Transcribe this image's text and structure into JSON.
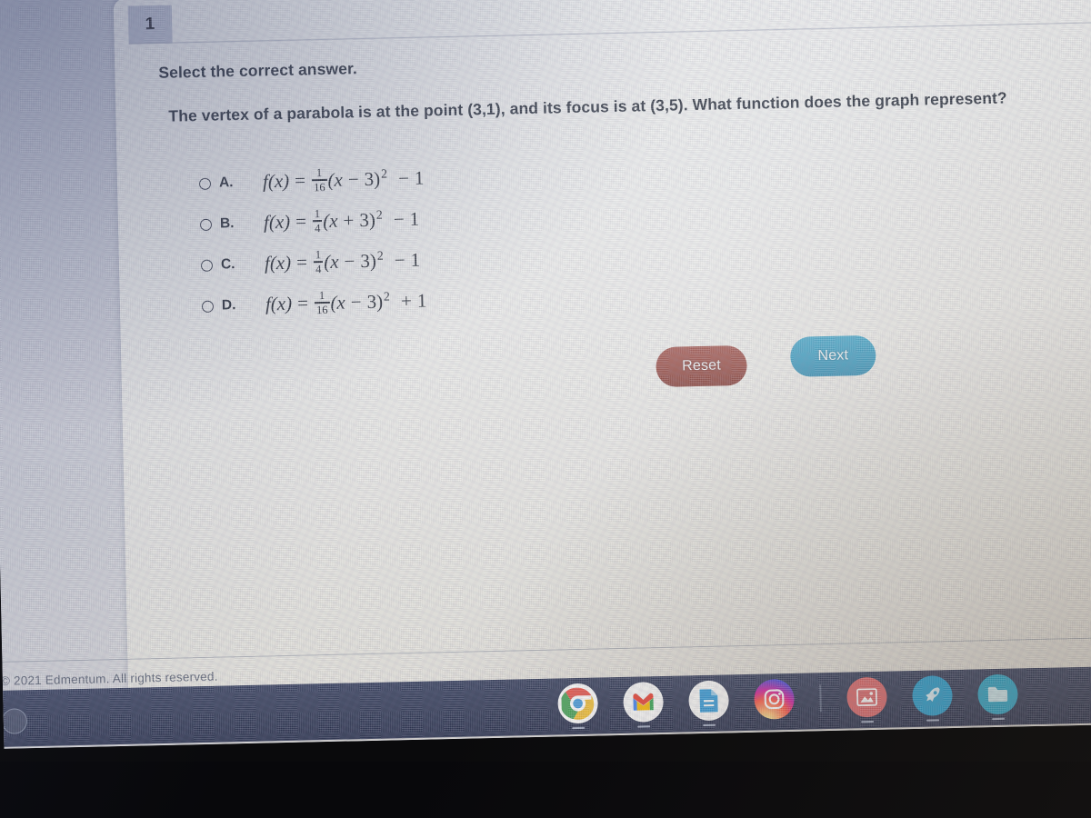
{
  "assessment": {
    "question_number": "1",
    "prompt": "Select the correct answer.",
    "question": "The vertex of a parabola is at the point (3,1), and its focus is at (3,5). What function does the graph represent?",
    "options": [
      {
        "letter": "A.",
        "selected": false,
        "expr_text": "f(x) = 1/16(x − 3)² − 1",
        "lhs": "f(x)",
        "eq": "=",
        "num": "1",
        "den": "16",
        "open": "(x",
        "sign": "−",
        "shift": "3)",
        "power": "2",
        "tail_sign": "−",
        "tail": "1"
      },
      {
        "letter": "B.",
        "selected": false,
        "expr_text": "f(x) = 1/4(x + 3)² − 1",
        "lhs": "f(x)",
        "eq": "=",
        "num": "1",
        "den": "4",
        "open": "(x",
        "sign": "+",
        "shift": "3)",
        "power": "2",
        "tail_sign": "−",
        "tail": "1"
      },
      {
        "letter": "C.",
        "selected": false,
        "expr_text": "f(x) = 1/4(x − 3)² − 1",
        "lhs": "f(x)",
        "eq": "=",
        "num": "1",
        "den": "4",
        "open": "(x",
        "sign": "−",
        "shift": "3)",
        "power": "2",
        "tail_sign": "−",
        "tail": "1"
      },
      {
        "letter": "D.",
        "selected": false,
        "expr_text": "f(x) = 1/16(x − 3)² + 1",
        "lhs": "f(x)",
        "eq": "=",
        "num": "1",
        "den": "16",
        "open": "(x",
        "sign": "−",
        "shift": "3)",
        "power": "2",
        "tail_sign": "+",
        "tail": "1"
      }
    ],
    "buttons": {
      "reset_label": "Reset",
      "next_label": "Next"
    },
    "footer": "© 2021 Edmentum. All rights reserved."
  },
  "colors": {
    "reset_button": "#8d3f38",
    "next_button": "#2f93ba",
    "question_tab": "#b6bcd0",
    "shelf": "#333b57",
    "card": "#e8e9e9",
    "text": "#1b2230"
  },
  "taskbar": {
    "items": [
      {
        "name": "chrome-icon",
        "label": "Chrome"
      },
      {
        "name": "gmail-icon",
        "label": "Gmail"
      },
      {
        "name": "docs-icon",
        "label": "Docs"
      },
      {
        "name": "instagram-icon",
        "label": "Instagram"
      },
      {
        "name": "photos-icon",
        "label": "Photos"
      },
      {
        "name": "app-icon",
        "label": "App"
      },
      {
        "name": "files-icon",
        "label": "Files"
      }
    ]
  }
}
